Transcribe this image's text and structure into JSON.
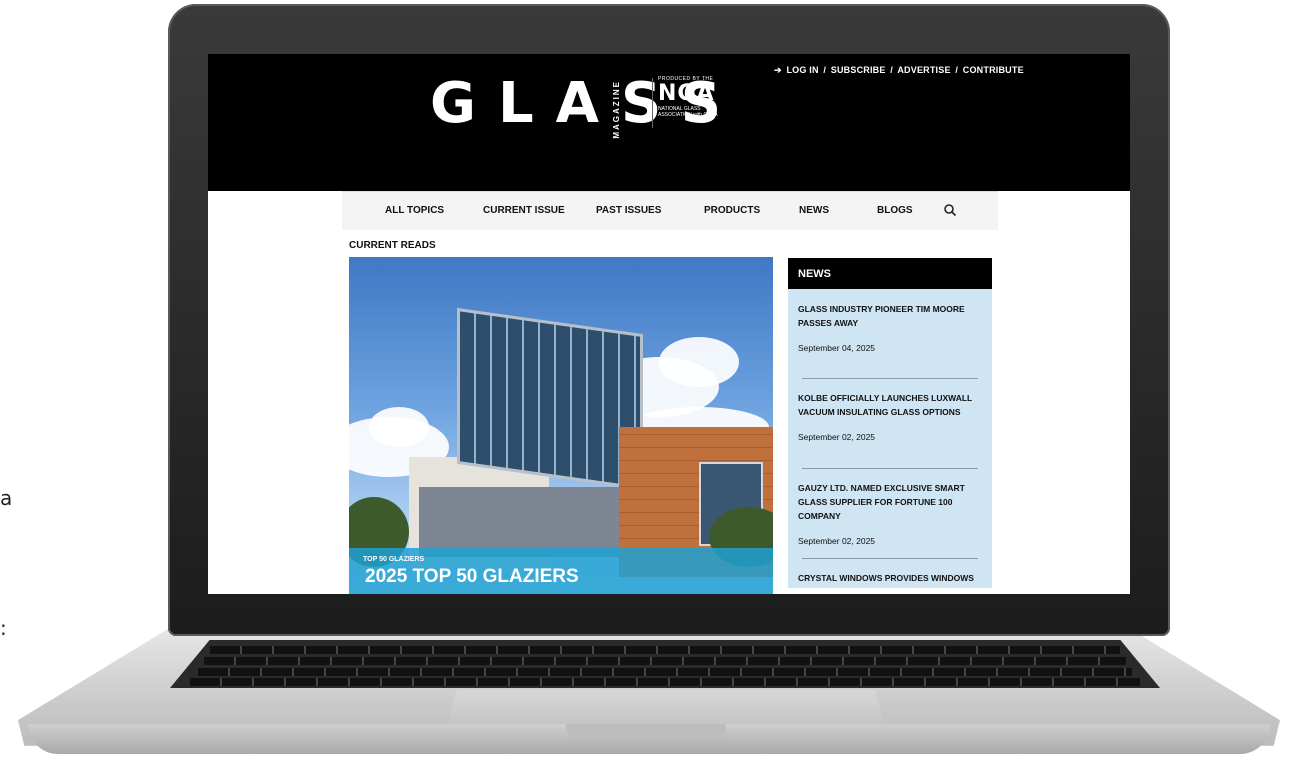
{
  "edge_fragments": [
    "a",
    ":"
  ],
  "header": {
    "logo_text": "GLASS",
    "logo_sub": "MAGAZINE",
    "produced_by": "PRODUCED BY THE",
    "nga_logo": "NGA",
    "nga_full": "NATIONAL GLASS ASSOCIATION with GANA",
    "top_links": {
      "login": "LOG IN",
      "separator": "/",
      "subscribe": "SUBSCRIBE",
      "advertise": "ADVERTISE",
      "contribute": "CONTRIBUTE"
    }
  },
  "nav": {
    "items": [
      "ALL TOPICS",
      "CURRENT ISSUE",
      "PAST ISSUES",
      "PRODUCTS",
      "NEWS",
      "BLOGS"
    ],
    "search_icon": "search-icon"
  },
  "main": {
    "section_label": "CURRENT READS",
    "hero": {
      "kicker": "TOP 50 GLAZIERS",
      "title": "2025 TOP 50 GLAZIERS"
    }
  },
  "news": {
    "heading": "NEWS",
    "items": [
      {
        "title": "GLASS INDUSTRY PIONEER TIM MOORE PASSES AWAY",
        "date": "September 04, 2025"
      },
      {
        "title": "KOLBE OFFICIALLY LAUNCHES LUXWALL VACUUM INSULATING GLASS OPTIONS",
        "date": "September 02, 2025"
      },
      {
        "title": "GAUZY LTD. NAMED EXCLUSIVE SMART GLASS SUPPLIER FOR FORTUNE 100 COMPANY",
        "date": "September 02, 2025"
      },
      {
        "title": "CRYSTAL WINDOWS PROVIDES WINDOWS FOR",
        "date": ""
      }
    ]
  },
  "colors": {
    "header_bg": "#000000",
    "news_panel_bg": "#cfe5f4",
    "hero_caption_bg": "#1ea0d2"
  }
}
